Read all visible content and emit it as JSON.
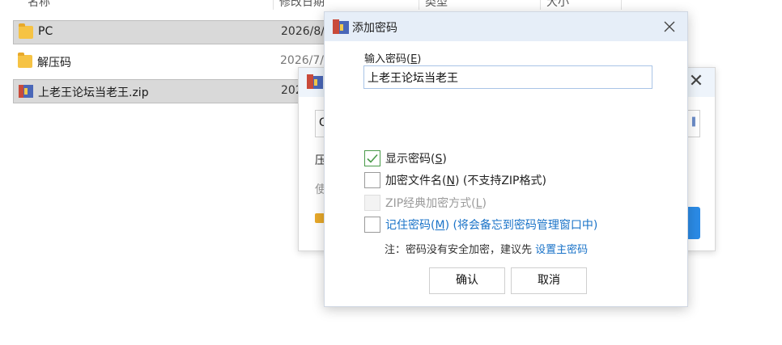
{
  "file_list": {
    "columns": [
      "名称",
      "修改日期",
      "类型",
      "大小"
    ],
    "rows": [
      {
        "name": "PC",
        "date": "2026/8/",
        "icon": "folder-icon"
      },
      {
        "name": "解压码",
        "date": "2026/7/",
        "icon": "folder-icon"
      },
      {
        "name": "上老王论坛当老王.zip",
        "date": "202",
        "icon": "zip-archive-icon"
      }
    ]
  },
  "background_dialog": {
    "input_value": "G",
    "line1": "压",
    "line2": "使",
    "close_glyph": "✕"
  },
  "dialog": {
    "title": "添加密码",
    "password_label_prefix": "输入密码(",
    "password_label_key": "E",
    "password_label_suffix": ")",
    "password_value": "上老王论坛当老王",
    "options": {
      "show_password": {
        "prefix": "显示密码(",
        "key": "S",
        "suffix": ")",
        "checked": true
      },
      "encrypt_filenames": {
        "prefix": "加密文件名(",
        "key": "N",
        "suffix": ") (不支持ZIP格式)",
        "checked": false
      },
      "zip_classic": {
        "prefix": "ZIP经典加密方式(",
        "key": "L",
        "suffix": ")",
        "checked": false
      },
      "remember_password": {
        "prefix": "记住密码(",
        "key": "M",
        "suffix": ") (将会备忘到密码管理窗口中)",
        "checked": false
      }
    },
    "note_text": "注：密码没有安全加密，建议先 ",
    "note_link": "设置主密码",
    "ok_label": "确认",
    "cancel_label": "取消"
  },
  "colors": {
    "accent_blue": "#1a73c8",
    "check_green": "#4a9a4a",
    "titlebar": "#e6eef8"
  }
}
